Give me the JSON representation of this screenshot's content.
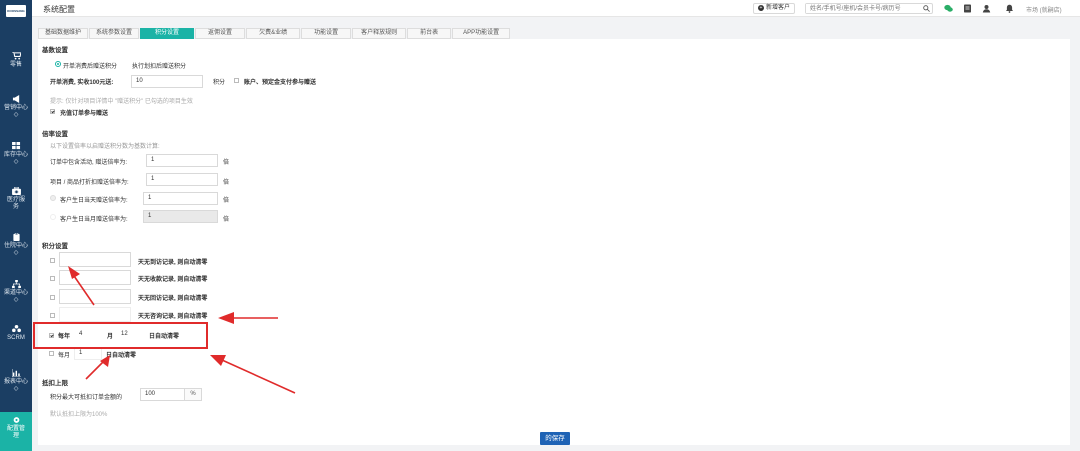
{
  "sidebar": {
    "logo_text": "KOOSSANG",
    "items": [
      {
        "label": "零售",
        "icon": "cart-icon"
      },
      {
        "label": "营销中心",
        "icon": "megaphone-icon"
      },
      {
        "label": "库存中心",
        "icon": "grid-icon"
      },
      {
        "label": "医疗服务",
        "icon": "medkit-icon"
      },
      {
        "label": "住院中心",
        "icon": "clipboard-icon"
      },
      {
        "label": "渠道中心",
        "icon": "sitemap-icon"
      },
      {
        "label": "SCRM",
        "icon": "share-icon"
      },
      {
        "label": "报表中心",
        "icon": "bar-chart-icon"
      },
      {
        "label": "配置管理",
        "icon": "gear-icon"
      }
    ]
  },
  "header": {
    "title": "系统配置",
    "new_customer_label": "新增客户",
    "search_placeholder": "姓名/手机号/座机/会员卡号/病历号",
    "user": "市场 (就嗣店)"
  },
  "tabs": [
    "基础数据维护",
    "系统参数设置",
    "积分设置",
    "返佣设置",
    "欠费&业绩",
    "功能设置",
    "客户释放规则",
    "前台表",
    "APP功能设置"
  ],
  "active_tab": "积分设置",
  "basic": {
    "title": "基数设置",
    "radio1": "开单消费后赠送积分",
    "radio2": "执行划扣后赠送积分",
    "spend_label": "开单消费, 实收100元送:",
    "spend_value": "10",
    "spend_unit": "积分",
    "account_label": "账户、预定金支付参与赠送",
    "hint": "提示: 仅针对项目详情中 \"赠送积分\" 已勾选的项目生效",
    "recharge_label": "充值订单参与赠送"
  },
  "multiplier": {
    "title": "倍率设置",
    "subtitle": "以下设置倍率以启赠送积分数为基数计算:",
    "rows": [
      {
        "label": "订单中包含活动, 赠送倍率为:",
        "value": "1",
        "unit": "倍"
      },
      {
        "label": "项目 / 商品打折扣赠送倍率为:",
        "value": "1",
        "unit": "倍"
      },
      {
        "label": "客户生日当天赠送倍率为:",
        "value": "1",
        "unit": "倍"
      },
      {
        "label": "客户生日当月赠送倍率为:",
        "value": "1",
        "unit": "倍"
      }
    ]
  },
  "points": {
    "title": "积分设置",
    "rows": [
      {
        "label": "天无到访记录, 则自动清零"
      },
      {
        "label": "天无收款记录, 则自动清零"
      },
      {
        "label": "天无回访记录, 则自动清零"
      },
      {
        "label": "天无咨询记录, 则自动清零"
      }
    ],
    "yearly": {
      "prefix": "每年",
      "month": "4",
      "month_label": "月",
      "day": "12",
      "suffix": "日自动清零"
    },
    "monthly": {
      "prefix": "每月",
      "day": "1",
      "suffix": "日自动清零"
    }
  },
  "deduct": {
    "title": "抵扣上限",
    "label": "积分最大可抵扣订单金额的",
    "value": "100",
    "unit": "%",
    "hint": "默认抵扣上限为100%"
  },
  "save_label": "的保存",
  "colors": {
    "sidebar": "#1b3e63",
    "accent": "#1bb3a6",
    "annotation": "#e02b2b",
    "save": "#1f63b5"
  }
}
